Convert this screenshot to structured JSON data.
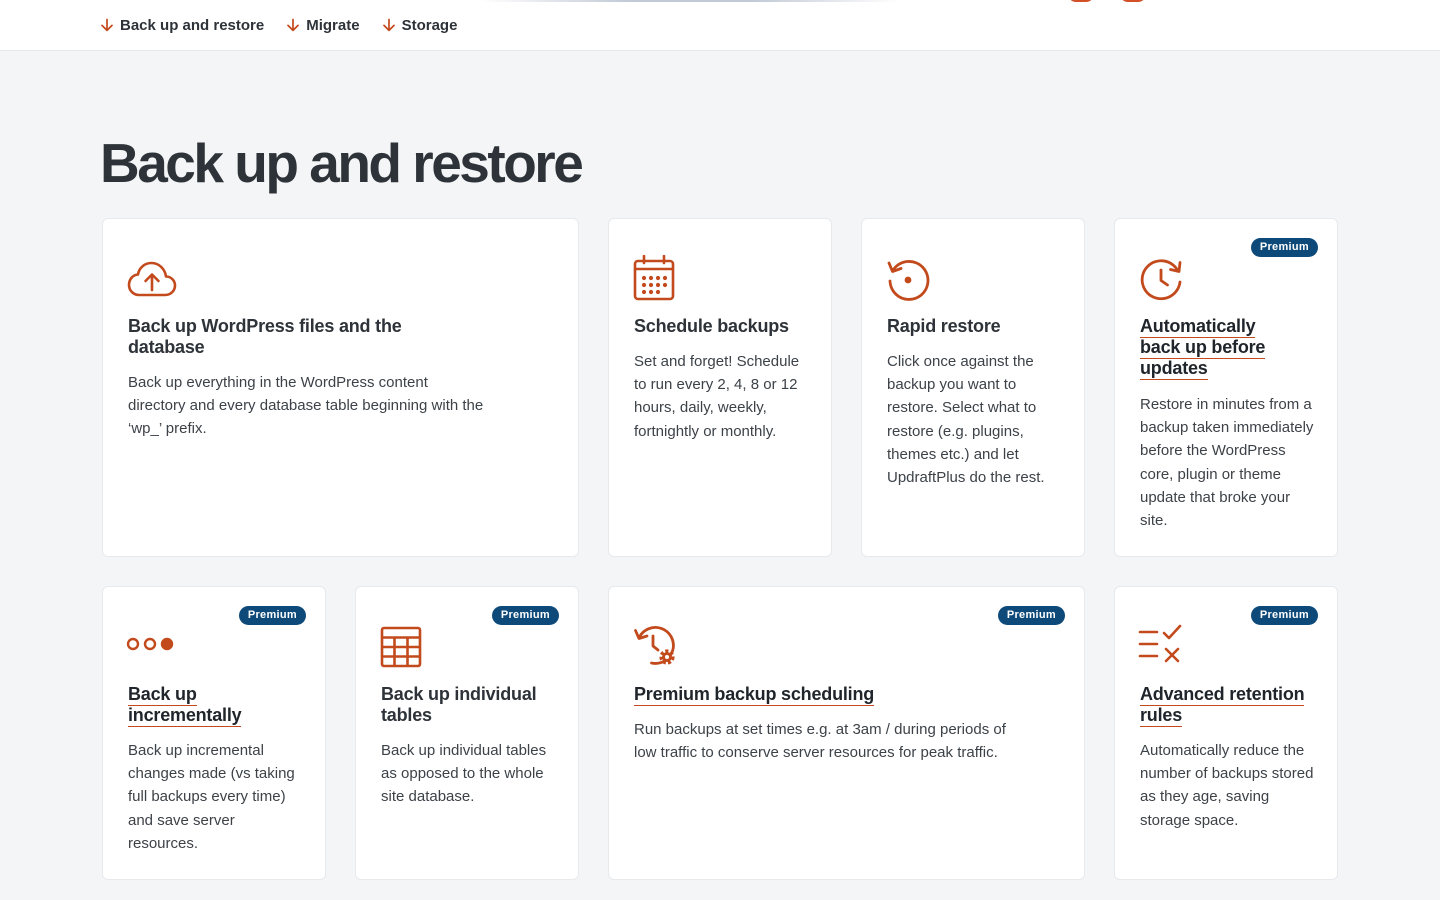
{
  "subnav": {
    "links": [
      {
        "label": "Back up and restore",
        "icon": "arrow-down-icon"
      },
      {
        "label": "Migrate",
        "icon": "arrow-down-icon"
      },
      {
        "label": "Storage",
        "icon": "arrow-down-icon"
      }
    ]
  },
  "section": {
    "title": "Back up and restore"
  },
  "colors": {
    "accent": "#c24a1c",
    "badge": "#0d4a7a",
    "heading": "#2d3339",
    "page_bg": "#f4f5f7"
  },
  "cards": [
    {
      "icon": "cloud-upload-icon",
      "title": "Back up WordPress files and the database",
      "description": "Back up everything in the WordPress content directory and every database table beginning with the ‘wp_’ prefix.",
      "premium": false
    },
    {
      "icon": "calendar-icon",
      "title": "Schedule backups",
      "description": "Set and forget! Schedule to run every 2, 4, 8 or 12 hours, daily, weekly, fortnightly or monthly.",
      "premium": false
    },
    {
      "icon": "restore-icon",
      "title": "Rapid restore",
      "description": "Click once against the backup you want to restore. Select what to restore (e.g. plugins, themes etc.) and let UpdraftPlus do the rest.",
      "premium": false
    },
    {
      "icon": "clock-refresh-icon",
      "title": "Automatically back up before updates",
      "description": "Restore in minutes from a backup taken immediately before the WordPress core, plugin or theme update that broke your site.",
      "premium": true,
      "badge": "Premium"
    },
    {
      "icon": "dots-progress-icon",
      "title": "Back up incrementally",
      "description": "Back up incremental changes made (vs taking full backups every time) and save server resources.",
      "premium": true,
      "badge": "Premium"
    },
    {
      "icon": "table-icon",
      "title": "Back up individual tables",
      "description": "Back up individual tables as opposed to the whole site database.",
      "premium": true,
      "badge": "Premium"
    },
    {
      "icon": "clock-gear-icon",
      "title": "Premium backup scheduling",
      "description": "Run backups at set times e.g. at 3am / during periods of low traffic to conserve server resources for peak traffic.",
      "premium": true,
      "badge": "Premium"
    },
    {
      "icon": "retention-rules-icon",
      "title": "Advanced retention rules",
      "description": "Automatically reduce the number of backups stored as they age, saving storage space.",
      "premium": true,
      "badge": "Premium"
    }
  ]
}
